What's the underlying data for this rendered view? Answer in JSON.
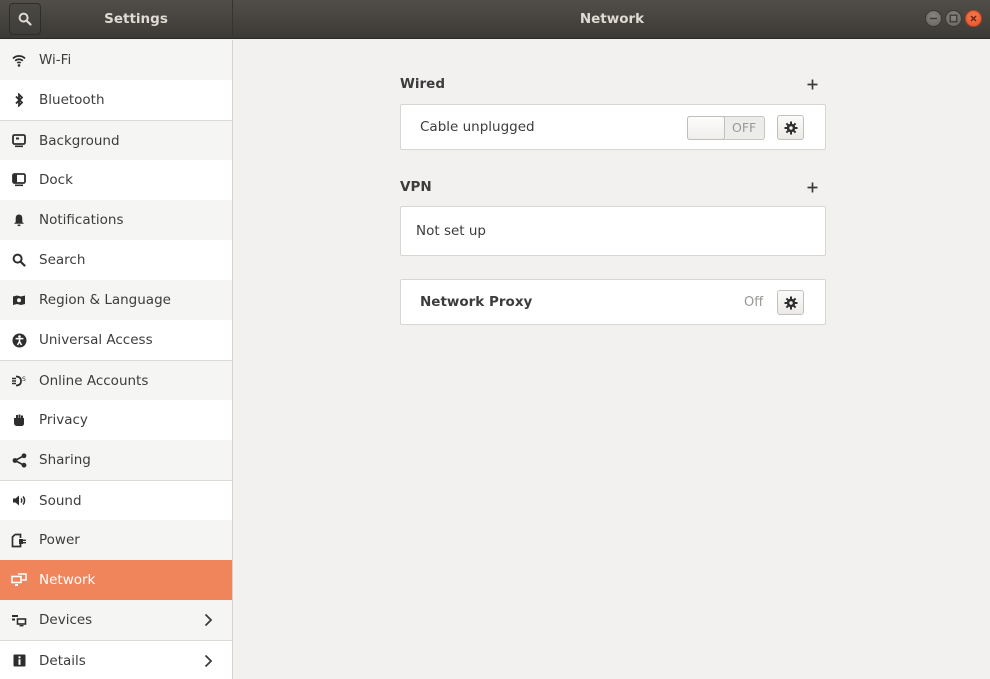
{
  "header": {
    "sidebar_title": "Settings",
    "panel_title": "Network",
    "search_icon": "search-icon",
    "window_buttons": [
      "minimize",
      "maximize",
      "close"
    ]
  },
  "sidebar": {
    "items": [
      {
        "label": "Wi-Fi",
        "icon": "wifi-icon"
      },
      {
        "label": "Bluetooth",
        "icon": "bluetooth-icon"
      },
      {
        "label": "Background",
        "icon": "background-icon"
      },
      {
        "label": "Dock",
        "icon": "dock-icon"
      },
      {
        "label": "Notifications",
        "icon": "bell-icon"
      },
      {
        "label": "Search",
        "icon": "search-icon"
      },
      {
        "label": "Region & Language",
        "icon": "region-icon"
      },
      {
        "label": "Universal Access",
        "icon": "accessibility-icon"
      },
      {
        "label": "Online Accounts",
        "icon": "online-accounts-icon"
      },
      {
        "label": "Privacy",
        "icon": "hand-icon"
      },
      {
        "label": "Sharing",
        "icon": "share-icon"
      },
      {
        "label": "Sound",
        "icon": "speaker-icon"
      },
      {
        "label": "Power",
        "icon": "power-icon"
      },
      {
        "label": "Network",
        "icon": "network-icon",
        "active": true
      },
      {
        "label": "Devices",
        "icon": "devices-icon",
        "has_submenu": true
      },
      {
        "label": "Details",
        "icon": "info-icon",
        "has_submenu": true
      }
    ]
  },
  "main": {
    "wired": {
      "title": "Wired",
      "add_label": "+",
      "connection": "Cable unplugged",
      "switch_state": "OFF"
    },
    "vpn": {
      "title": "VPN",
      "add_label": "+",
      "status": "Not set up"
    },
    "proxy": {
      "title": "Network Proxy",
      "status": "Off"
    }
  },
  "colors": {
    "accent": "#f0845a",
    "headerbar": "#46433f",
    "close_button": "#e95420"
  }
}
